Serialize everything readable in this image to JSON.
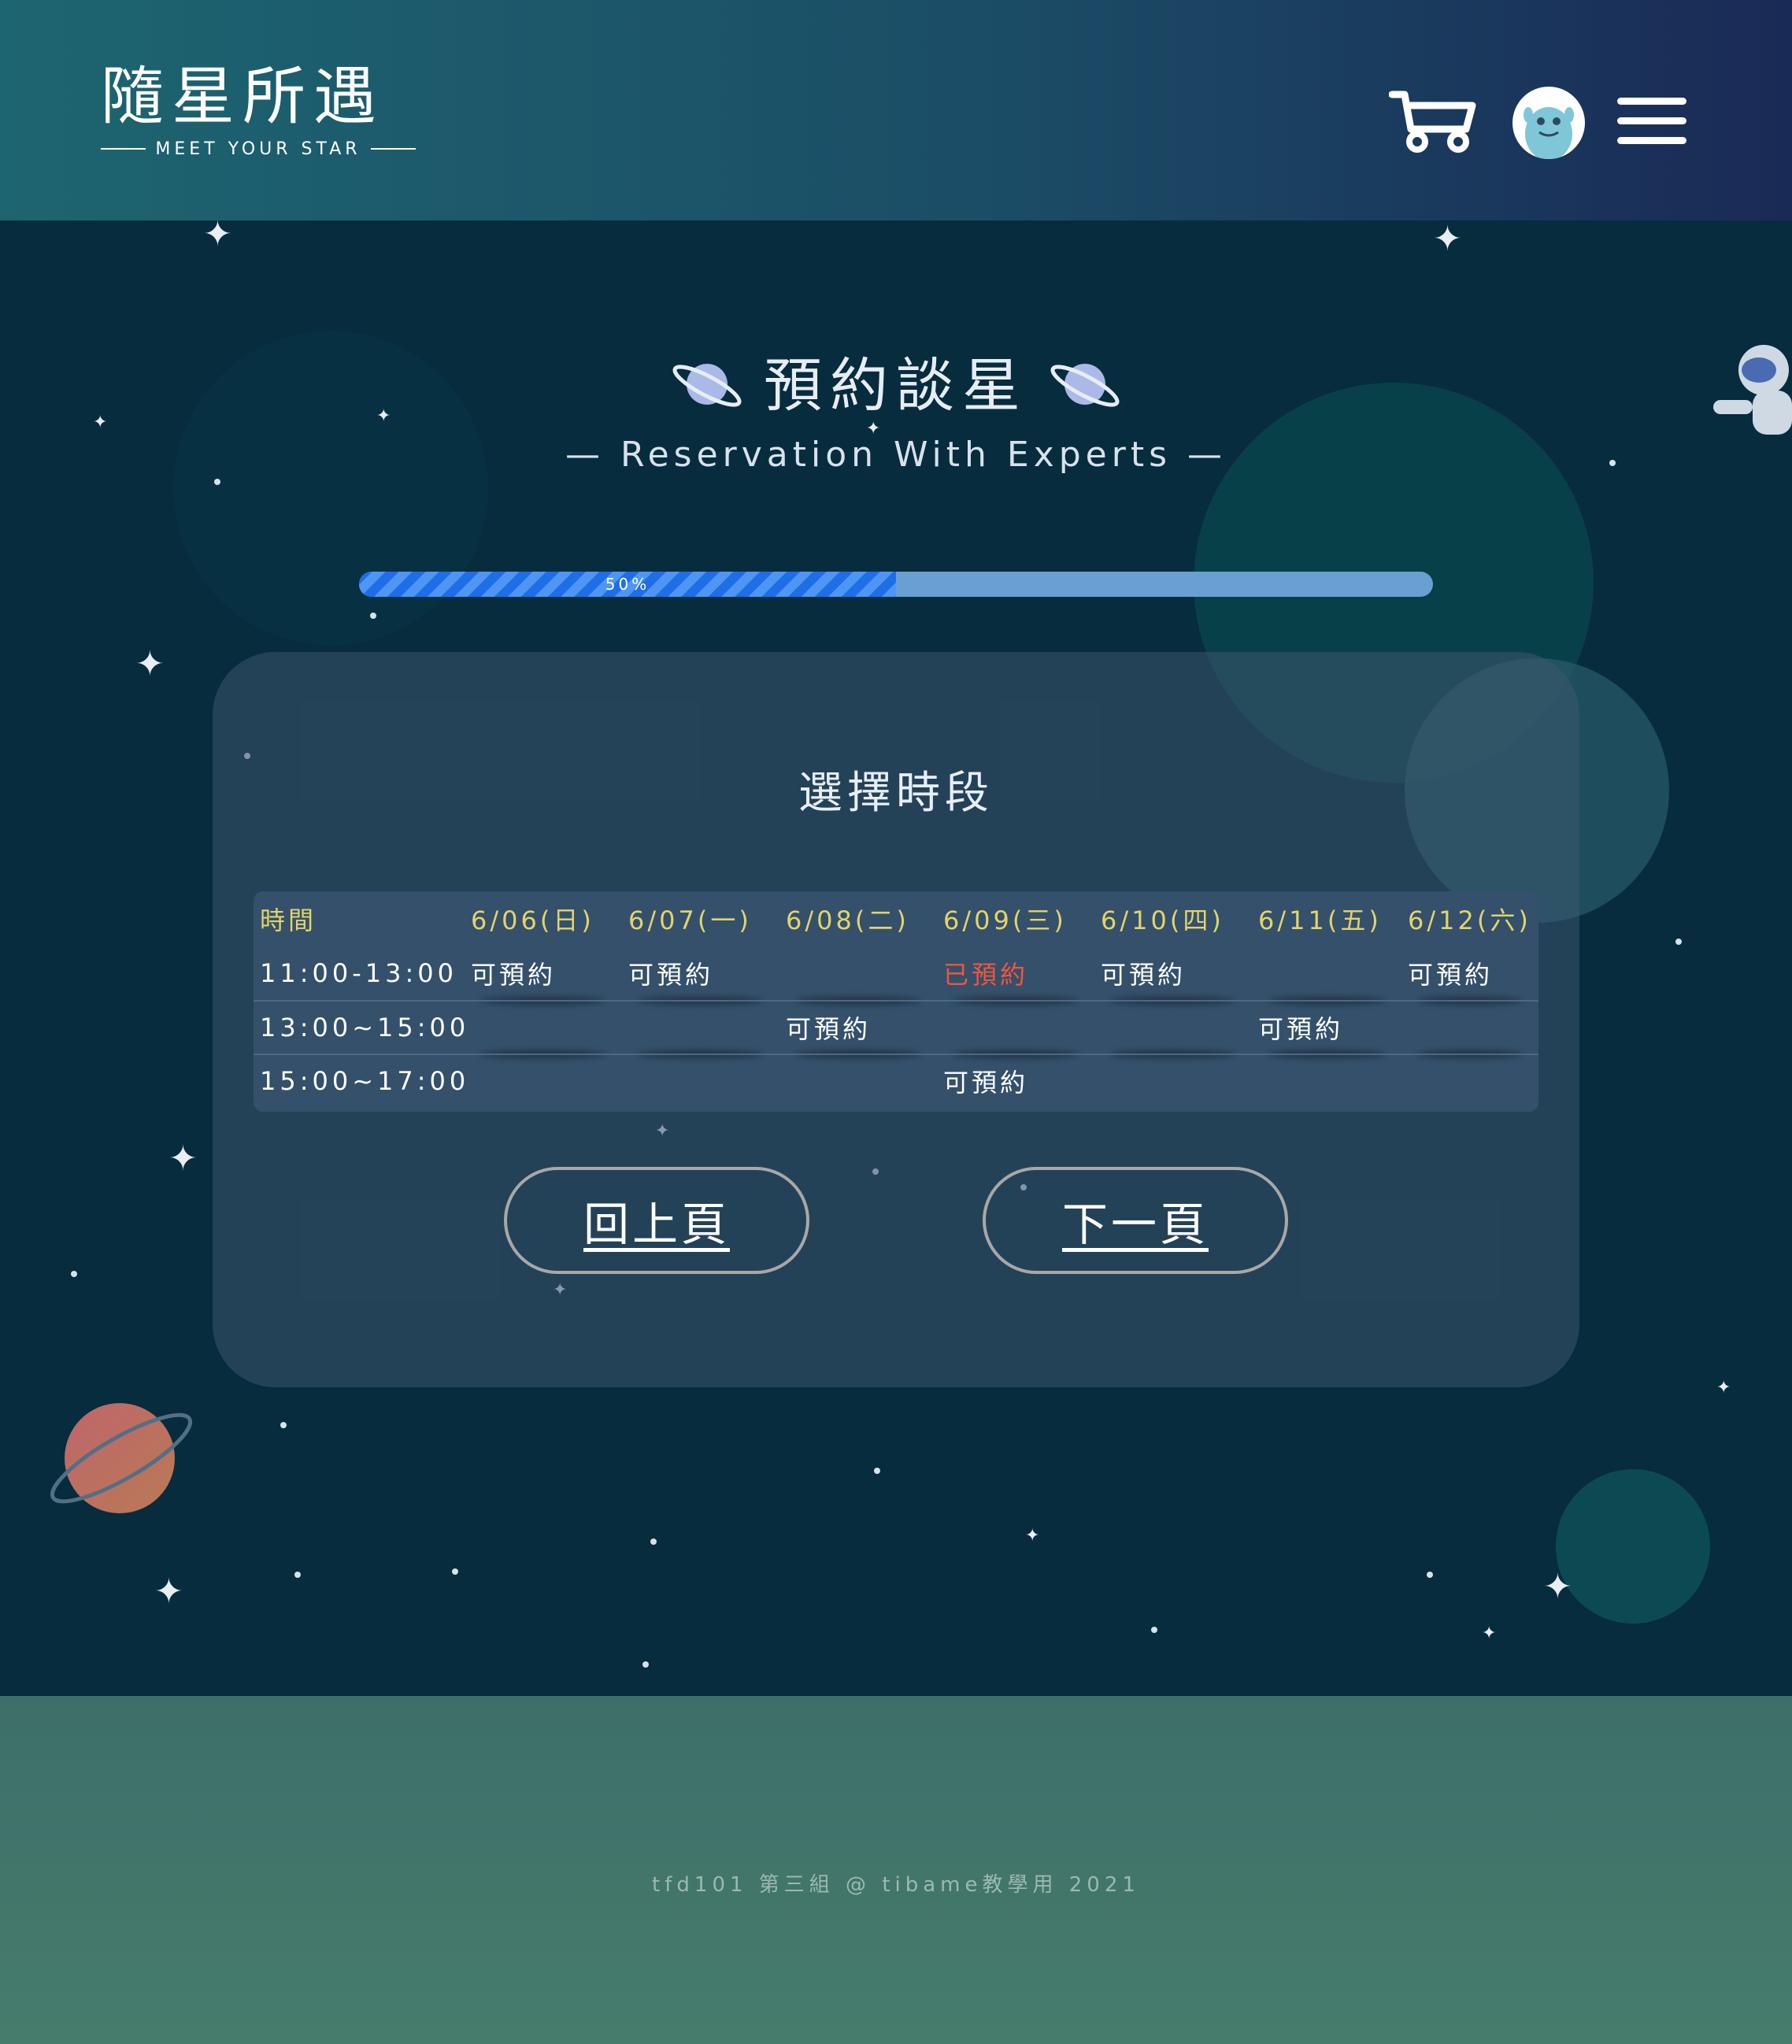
{
  "header": {
    "logo_title": "隨星所遇",
    "logo_subtitle": "MEET YOUR STAR",
    "icons": [
      "cart-icon",
      "avatar-icon",
      "menu-icon"
    ]
  },
  "page": {
    "title": "預約談星",
    "subtitle": "— Reservation With Experts —"
  },
  "progress": {
    "percent": 50,
    "label": "50%"
  },
  "schedule": {
    "heading": "選擇時段",
    "time_header": "時間",
    "dates": [
      "6/06(日)",
      "6/07(一)",
      "6/08(二)",
      "6/09(三)",
      "6/10(四)",
      "6/11(五)",
      "6/12(六)"
    ],
    "rows": [
      {
        "time": "11:00-13:00",
        "slots": [
          "可預約",
          "可預約",
          "",
          "已預約",
          "可預約",
          "",
          "可預約"
        ]
      },
      {
        "time": "13:00~15:00",
        "slots": [
          "",
          "",
          "可預約",
          "",
          "",
          "可預約",
          ""
        ]
      },
      {
        "time": "15:00~17:00",
        "slots": [
          "",
          "",
          "",
          "可預約",
          "",
          "",
          ""
        ]
      }
    ]
  },
  "buttons": {
    "prev": "回上頁",
    "next": "下一頁"
  },
  "footer": {
    "text": "tfd101 第三組 @ tibame教學用 2021"
  },
  "colors": {
    "header_start": "#1d6570",
    "header_end": "#1a2a56",
    "background": "#062c3e",
    "date_header": "#e3d36a",
    "booked": "#f2553d",
    "progress_fill": "#1e6ee8",
    "progress_track": "#6a9fd4",
    "footer": "#3d6f68"
  }
}
